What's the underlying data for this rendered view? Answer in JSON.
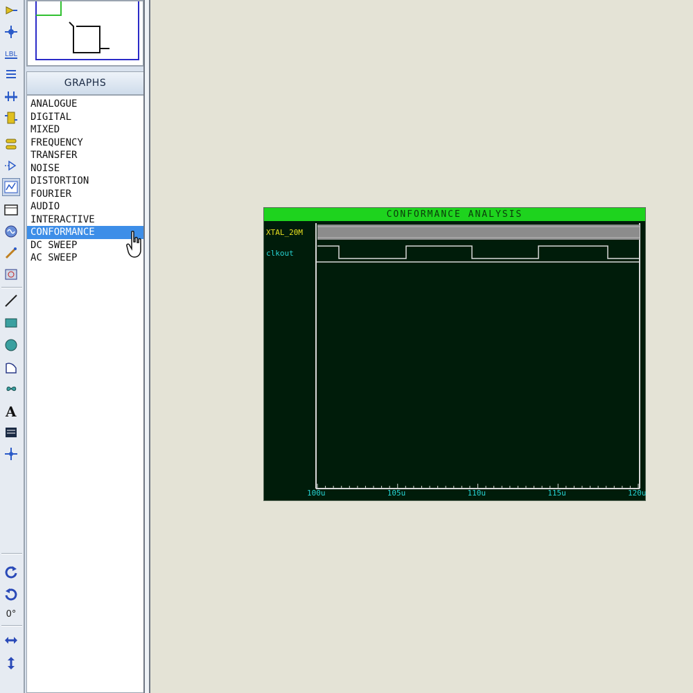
{
  "panel": {
    "graphs_header": "GRAPHS",
    "graph_types": [
      "ANALOGUE",
      "DIGITAL",
      "MIXED",
      "FREQUENCY",
      "TRANSFER",
      "NOISE",
      "DISTORTION",
      "FOURIER",
      "AUDIO",
      "INTERACTIVE",
      "CONFORMANCE",
      "DC SWEEP",
      "AC SWEEP"
    ],
    "selected_index": 10
  },
  "graph": {
    "title": "CONFORMANCE ANALYSIS",
    "traces": [
      {
        "name": "XTAL_20M",
        "color": "#e8e020",
        "signal": "fast-clock"
      },
      {
        "name": "clkout",
        "color": "#27d3d3",
        "signal": "square-wave"
      }
    ],
    "x_ticks": [
      "100u",
      "105u",
      "110u",
      "115u",
      "120u"
    ],
    "colors": {
      "title_bar": "#1ed31e",
      "background": "#001c0a",
      "axis": "#d8d8d8",
      "tick_label": "#27d3d3"
    }
  },
  "toolbar": {
    "icons": [
      "terminal-icon",
      "junction-icon",
      "label-icon",
      "text-script-icon",
      "bus-icon",
      "subcircuit-icon",
      "terminals-icon",
      "device-pins-icon",
      "graph-icon",
      "tape-recorder-icon",
      "generator-icon",
      "voltage-probe-icon",
      "virtual-instruments-icon",
      "line-icon",
      "box-icon",
      "circle-icon",
      "arc-icon",
      "path-icon",
      "text-icon",
      "symbol-icon",
      "marker-icon",
      "rotate-cw-icon",
      "rotate-ccw-icon",
      "angle-icon",
      "mirror-horizontal-icon",
      "mirror-vertical-icon"
    ],
    "angle_value": "0°"
  }
}
